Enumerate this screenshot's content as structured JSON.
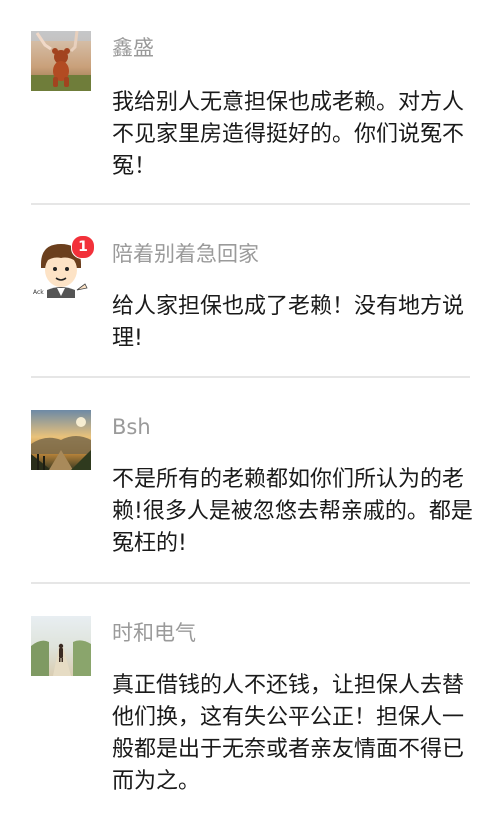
{
  "comments": [
    {
      "username": "鑫盛",
      "avatar_icon": "teddy-bear-photo-icon",
      "text": "我给别人无意担保也成老赖。对方人不见家里房造得挺好的。你们说冤不冤！"
    },
    {
      "username": "陪着别着急回家",
      "avatar_icon": "cartoon-boy-icon",
      "badge": "1",
      "text": "给人家担保也成了老赖！没有地方说理!"
    },
    {
      "username": "Bsh",
      "avatar_icon": "mountain-sunset-photo-icon",
      "text": "不是所有的老赖都如你们所认为的老赖!很多人是被忽悠去帮亲戚的。都是冤枉的!"
    },
    {
      "username": "时和电气",
      "avatar_icon": "country-road-photo-icon",
      "text": "真正借钱的人不还钱，让担保人去替他们换，这有失公平公正！担保人一般都是出于无奈或者亲友情面不得已而为之。"
    }
  ],
  "colors": {
    "username": "#9a9a9a",
    "text": "#1a1a1a",
    "divider": "#e6e6e6",
    "badge": "#f2313a"
  }
}
